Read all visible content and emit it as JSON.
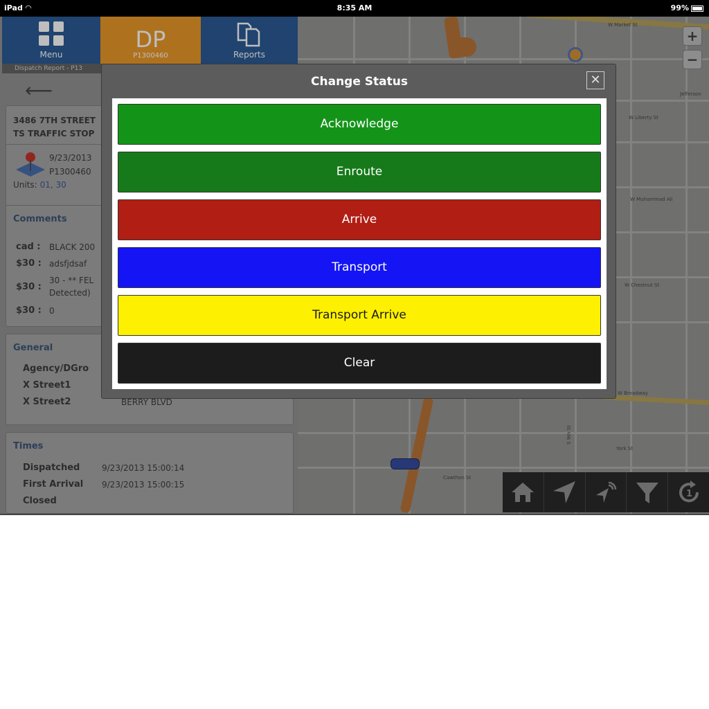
{
  "status_bar": {
    "device": "iPad",
    "time": "8:35 AM",
    "battery": "99%"
  },
  "nav": {
    "menu_label": "Menu",
    "dp_label": "DP",
    "dp_id": "P1300460",
    "reports_label": "Reports"
  },
  "breadcrumb": "Dispatch Report - P13",
  "incident": {
    "address": "3486 7TH STREET",
    "type": "TS TRAFFIC STOP",
    "date": "9/23/2013",
    "id": "P1300460",
    "units_label": "Units:",
    "units_value": "01, 30"
  },
  "comments": {
    "title": "Comments",
    "rows": [
      {
        "key": "cad :",
        "value": "BLACK 200"
      },
      {
        "key": "$30 :",
        "value": "adsfjdsaf"
      },
      {
        "key": "$30 :",
        "value": "30 - ** FEL",
        "value2": "Detected)"
      },
      {
        "key": "$30 :",
        "value": "0"
      }
    ]
  },
  "general": {
    "title": "General",
    "rows": [
      {
        "key": "Agency/DGro",
        "value": ""
      },
      {
        "key": "X Street1",
        "value": ""
      },
      {
        "key": "X Street2",
        "value": "BERRY BLVD"
      }
    ]
  },
  "times": {
    "title": "Times",
    "rows": [
      {
        "key": "Dispatched",
        "value": "9/23/2013 15:00:14"
      },
      {
        "key": "First Arrival",
        "value": "9/23/2013 15:00:15"
      },
      {
        "key": "Closed",
        "value": ""
      }
    ]
  },
  "map": {
    "zoom_in": "+",
    "zoom_out": "−",
    "labels": {
      "w_market": "W Market St",
      "jefferson": "Jefferson",
      "liberty": "W Liberty St",
      "muhammad": "W Muhammad Ali",
      "chestnut": "W Chestnut St",
      "broadway": "W Broadway",
      "cawthon": "Cawthon St",
      "york": "York St",
      "s_9th": "S 9th St"
    }
  },
  "modal": {
    "title": "Change Status",
    "close": "✕",
    "buttons": [
      {
        "label": "Acknowledge",
        "bg": "#139419",
        "fg": "#ffffff"
      },
      {
        "label": "Enroute",
        "bg": "#167a1a",
        "fg": "#ffffff"
      },
      {
        "label": "Arrive",
        "bg": "#b11e14",
        "fg": "#ffffff"
      },
      {
        "label": "Transport",
        "bg": "#1414f5",
        "fg": "#ffffff"
      },
      {
        "label": "Transport Arrive",
        "bg": "#fdf000",
        "fg": "#1a1a1a"
      },
      {
        "label": "Clear",
        "bg": "#1c1c1c",
        "fg": "#ffffff"
      }
    ]
  },
  "icons": {
    "menu": "grid-icon",
    "reports": "documents-icon",
    "back": "back-arrow-icon",
    "incident": "map-pin-icon",
    "toolbar": [
      "home-icon",
      "navigate-icon",
      "signal-icon",
      "filter-icon",
      "refresh-icon"
    ]
  }
}
